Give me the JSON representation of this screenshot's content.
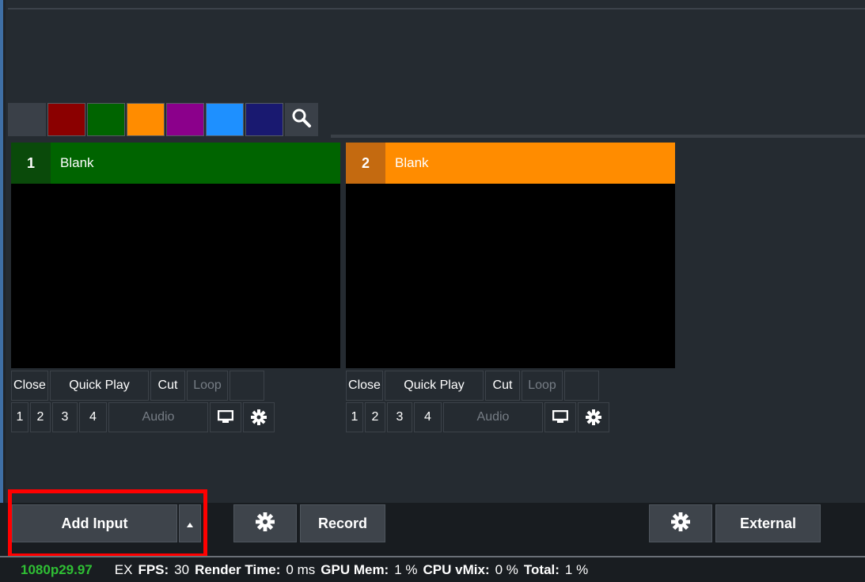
{
  "colors": {
    "background": "#252b31",
    "green": "#006400",
    "orange": "#ff8c00",
    "highlight": "#ff0000",
    "status_green": "#2fbf34"
  },
  "swatches": [
    {
      "name": "none",
      "color": "#3a4048"
    },
    {
      "name": "red",
      "color": "#8b0000"
    },
    {
      "name": "green",
      "color": "#006400"
    },
    {
      "name": "orange",
      "color": "#ff8c00"
    },
    {
      "name": "purple",
      "color": "#8b008b"
    },
    {
      "name": "blue",
      "color": "#1e90ff"
    },
    {
      "name": "navy",
      "color": "#191970"
    }
  ],
  "search_icon": "search-icon",
  "inputs": [
    {
      "number": "1",
      "title": "Blank",
      "header_color": "#006400",
      "number_color": "#0a4a0a",
      "controls_row1": [
        "Close",
        "Quick Play",
        "Cut",
        "Loop"
      ],
      "controls_row2": [
        "1",
        "2",
        "3",
        "4",
        "Audio"
      ]
    },
    {
      "number": "2",
      "title": "Blank",
      "header_color": "#ff8c00",
      "number_color": "#c46a10",
      "controls_row1": [
        "Close",
        "Quick Play",
        "Cut",
        "Loop"
      ],
      "controls_row2": [
        "1",
        "2",
        "3",
        "4",
        "Audio"
      ]
    }
  ],
  "toolbar": {
    "add_input": "Add Input",
    "record": "Record",
    "external": "External"
  },
  "status": {
    "resolution": "1080p29.97",
    "ex": "EX",
    "fps_label": "FPS:",
    "fps_value": "30",
    "render_label": "Render Time:",
    "render_value": "0 ms",
    "gpu_label": "GPU Mem:",
    "gpu_value": "1 %",
    "cpu_label": "CPU vMix:",
    "cpu_value": "0 %",
    "total_label": "Total:",
    "total_value": "1 %"
  }
}
